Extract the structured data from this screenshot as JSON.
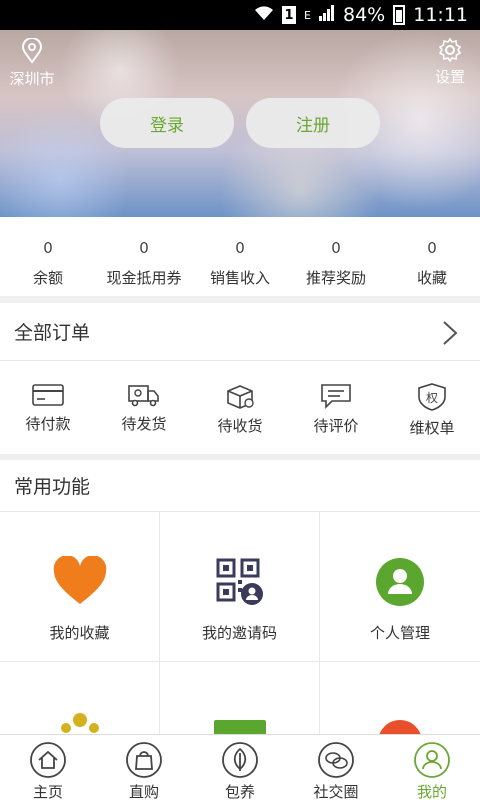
{
  "statusbar": {
    "network": "E",
    "battery": "84%",
    "time": "11:11"
  },
  "hero": {
    "location": "深圳市",
    "settings_label": "设置",
    "login_label": "登录",
    "register_label": "注册"
  },
  "stats": [
    {
      "value": "0",
      "label": "余额"
    },
    {
      "value": "0",
      "label": "现金抵用券"
    },
    {
      "value": "0",
      "label": "销售收入"
    },
    {
      "value": "0",
      "label": "推荐奖励"
    },
    {
      "value": "0",
      "label": "收藏"
    }
  ],
  "orders": {
    "title": "全部订单",
    "items": [
      {
        "label": "待付款",
        "icon": "card-icon"
      },
      {
        "label": "待发货",
        "icon": "truck-icon"
      },
      {
        "label": "待收货",
        "icon": "package-icon"
      },
      {
        "label": "待评价",
        "icon": "comment-icon"
      },
      {
        "label": "维权单",
        "icon": "shield-icon",
        "badge": "权"
      }
    ]
  },
  "functions": {
    "title": "常用功能",
    "items": [
      {
        "label": "我的收藏",
        "icon": "heart-icon",
        "color": "#f07d1c"
      },
      {
        "label": "我的邀请码",
        "icon": "qr-code-icon",
        "color": "#3a3a5a"
      },
      {
        "label": "个人管理",
        "icon": "user-icon",
        "color": "#5aa62e"
      }
    ]
  },
  "bottomnav": [
    {
      "label": "主页",
      "icon": "home-icon"
    },
    {
      "label": "直购",
      "icon": "bag-icon"
    },
    {
      "label": "包养",
      "icon": "leaf-icon"
    },
    {
      "label": "社交圈",
      "icon": "chat-icon"
    },
    {
      "label": "我的",
      "icon": "profile-icon",
      "active": true
    }
  ],
  "colors": {
    "accent": "#6aa832",
    "heart": "#f07d1c",
    "user": "#5aa62e"
  }
}
